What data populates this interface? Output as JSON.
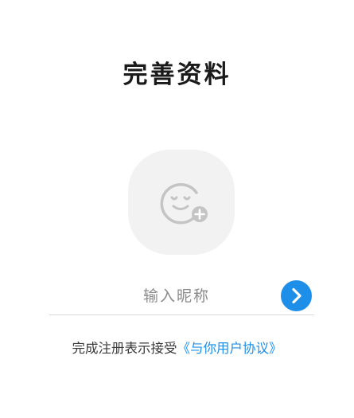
{
  "page": {
    "title": "完善资料"
  },
  "avatar": {
    "icon": "smiley-add-icon",
    "background_color": "#f2f2f2",
    "icon_color": "#c4c4c4"
  },
  "nickname": {
    "value": "",
    "placeholder": "输入昵称"
  },
  "submit": {
    "icon": "chevron-right-icon",
    "color": "#1e8fe8"
  },
  "agreement": {
    "text": "完成注册表示接受",
    "link_text": "《与你用户协议》",
    "link_color": "#1e8fe8"
  }
}
